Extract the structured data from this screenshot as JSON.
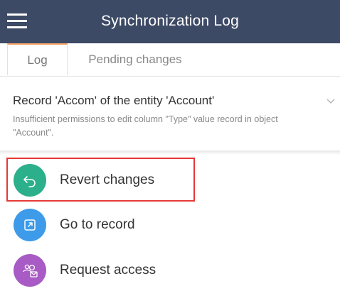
{
  "header": {
    "title": "Synchronization Log",
    "menu_icon": "hamburger-menu-icon"
  },
  "tabs": [
    {
      "label": "Log",
      "active": true
    },
    {
      "label": "Pending changes",
      "active": false
    }
  ],
  "record": {
    "title": "Record 'Accom' of the entity 'Account'",
    "message": "Insufficient permissions to edit column \"Type\" value record in object \"Account\".",
    "expand_icon": "chevron-down-icon"
  },
  "actions": [
    {
      "label": "Revert changes",
      "icon": "revert-icon",
      "color": "#2bb08b",
      "highlighted": true
    },
    {
      "label": "Go to record",
      "icon": "open-record-icon",
      "color": "#3d9be9",
      "highlighted": false
    },
    {
      "label": "Request access",
      "icon": "request-access-icon",
      "color": "#a85bc4",
      "highlighted": false
    }
  ],
  "colors": {
    "header_bg": "#3d4a66",
    "tab_active_accent": "#f6a46b",
    "highlight_border": "#e53935"
  }
}
